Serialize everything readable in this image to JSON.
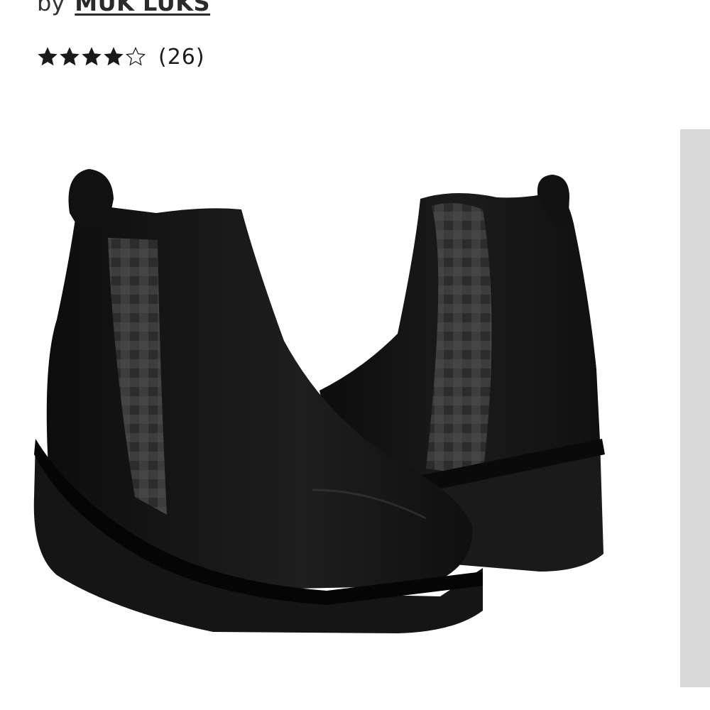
{
  "product": {
    "by_label": "by",
    "brand": "MUK LUKS",
    "rating_stars": 4,
    "rating_max": 5,
    "review_count_label": "(26)"
  },
  "image": {
    "icon": "black-wedge-chelsea-boots"
  },
  "colors": {
    "text": "#1a1a1a",
    "scroll_track": "#d9d9d9",
    "boot": "#141414",
    "plaid": "#3a3a3a"
  }
}
